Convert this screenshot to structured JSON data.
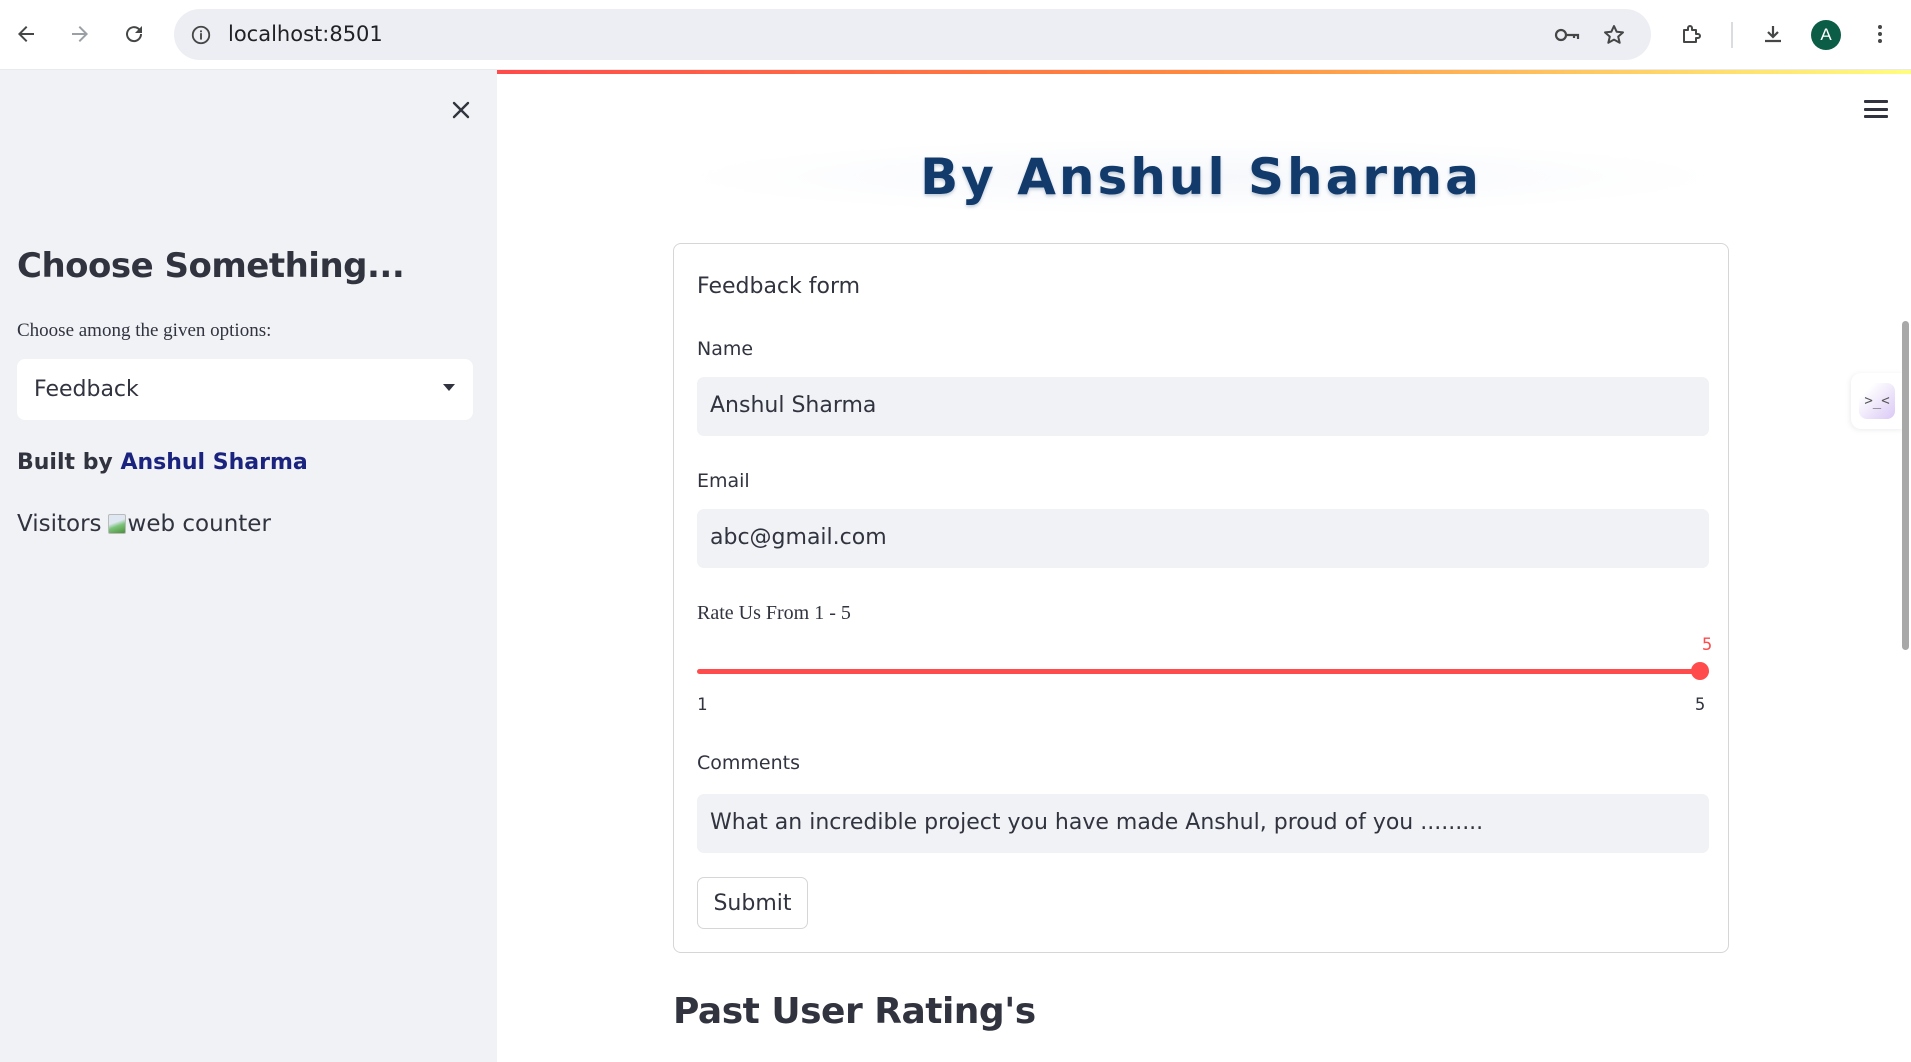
{
  "browser": {
    "url": "localhost:8501",
    "avatar_letter": "A"
  },
  "sidebar": {
    "title": "Choose Something...",
    "select_label": "Choose among the given options:",
    "select_value": "Feedback",
    "built_by_prefix": "Built by ",
    "built_by_name": "Anshul Sharma",
    "visitors_label": "Visitors",
    "counter_alt": "web counter"
  },
  "main": {
    "banner": "By Anshul Sharma",
    "form": {
      "title": "Feedback form",
      "name_label": "Name",
      "name_value": "Anshul Sharma",
      "email_label": "Email",
      "email_value": "abc@gmail.com",
      "rating_label": "Rate Us From 1 - 5",
      "rating_value": "5",
      "rating_min": "1",
      "rating_max": "5",
      "comments_label": "Comments",
      "comments_value": "What an incredible project you have made Anshul, proud of you .........",
      "submit_label": "Submit"
    },
    "section_title": "Past User Rating's"
  },
  "colors": {
    "accent": "#ff4b4b",
    "sidebar_bg": "#f0f2f6",
    "banner_text": "#123a6b"
  }
}
